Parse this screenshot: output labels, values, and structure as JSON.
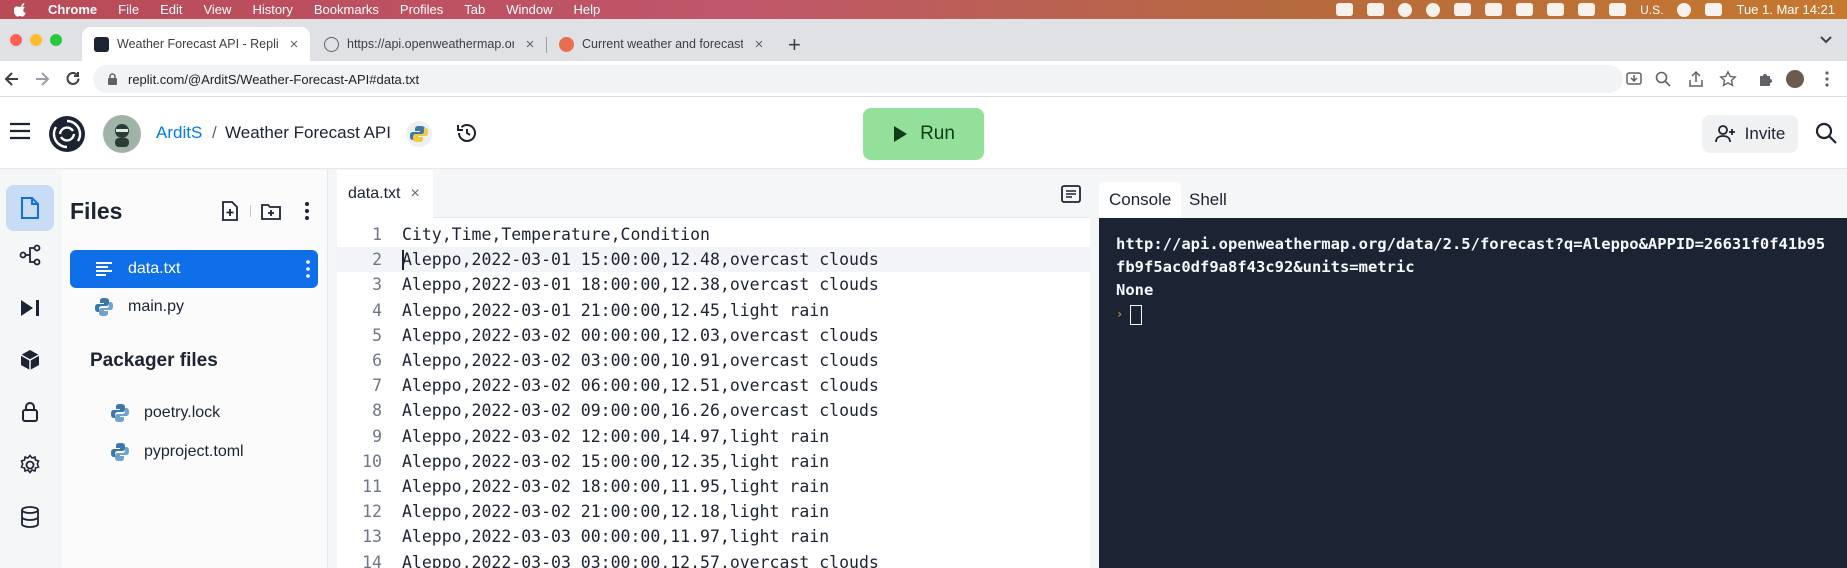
{
  "menubar": {
    "app": "Chrome",
    "items": [
      "File",
      "Edit",
      "View",
      "History",
      "Bookmarks",
      "Profiles",
      "Tab",
      "Window",
      "Help"
    ],
    "locale": "U.S.",
    "clock": "Tue 1. Mar  14:21"
  },
  "browser": {
    "tabs": [
      {
        "title": "Weather Forecast API - Replit",
        "icon": "replit-favicon"
      },
      {
        "title": "https://api.openweathermap.or",
        "icon": "globe-favicon"
      },
      {
        "title": "Current weather and forecast -",
        "icon": "openweather-favicon"
      }
    ],
    "new_tab": "+",
    "url": "replit.com/@ArditS/Weather-Forecast-API#data.txt"
  },
  "header": {
    "user": "ArditS",
    "separator": "/",
    "project": "Weather Forecast API",
    "run_label": "Run",
    "invite_label": "Invite"
  },
  "files": {
    "title": "Files",
    "items": [
      {
        "name": "data.txt",
        "icon": "text-file-icon",
        "selected": true
      },
      {
        "name": "main.py",
        "icon": "python-icon",
        "selected": false
      }
    ],
    "packager_title": "Packager files",
    "packager_items": [
      {
        "name": "poetry.lock",
        "icon": "python-icon"
      },
      {
        "name": "pyproject.toml",
        "icon": "python-icon"
      }
    ]
  },
  "editor": {
    "tab_label": "data.txt",
    "tab_close": "×",
    "current_line": 2,
    "lines": [
      {
        "n": "1",
        "text": "City,Time,Temperature,Condition"
      },
      {
        "n": "2",
        "text": "Aleppo,2022-03-01 15:00:00,12.48,overcast clouds"
      },
      {
        "n": "3",
        "text": "Aleppo,2022-03-01 18:00:00,12.38,overcast clouds"
      },
      {
        "n": "4",
        "text": "Aleppo,2022-03-01 21:00:00,12.45,light rain"
      },
      {
        "n": "5",
        "text": "Aleppo,2022-03-02 00:00:00,12.03,overcast clouds"
      },
      {
        "n": "6",
        "text": "Aleppo,2022-03-02 03:00:00,10.91,overcast clouds"
      },
      {
        "n": "7",
        "text": "Aleppo,2022-03-02 06:00:00,12.51,overcast clouds"
      },
      {
        "n": "8",
        "text": "Aleppo,2022-03-02 09:00:00,16.26,overcast clouds"
      },
      {
        "n": "9",
        "text": "Aleppo,2022-03-02 12:00:00,14.97,light rain"
      },
      {
        "n": "10",
        "text": "Aleppo,2022-03-02 15:00:00,12.35,light rain"
      },
      {
        "n": "11",
        "text": "Aleppo,2022-03-02 18:00:00,11.95,light rain"
      },
      {
        "n": "12",
        "text": "Aleppo,2022-03-02 21:00:00,12.18,light rain"
      },
      {
        "n": "13",
        "text": "Aleppo,2022-03-03 00:00:00,11.97,light rain"
      },
      {
        "n": "14",
        "text": "Aleppo,2022-03-03 03:00:00,12.57,overcast clouds"
      }
    ]
  },
  "console": {
    "tabs": [
      "Console",
      "Shell"
    ],
    "active_tab": "Console",
    "output": [
      "http://api.openweathermap.org/data/2.5/forecast?q=Aleppo&APPID=26631f0f41b95fb9f5ac0df9a8f43c92&units=metric",
      "None"
    ],
    "prompt_symbol": "›"
  },
  "colors": {
    "accent": "#0f6fe8",
    "run_button": "#93e09a",
    "console_bg": "#1c2333",
    "user_link": "#0079f2"
  }
}
